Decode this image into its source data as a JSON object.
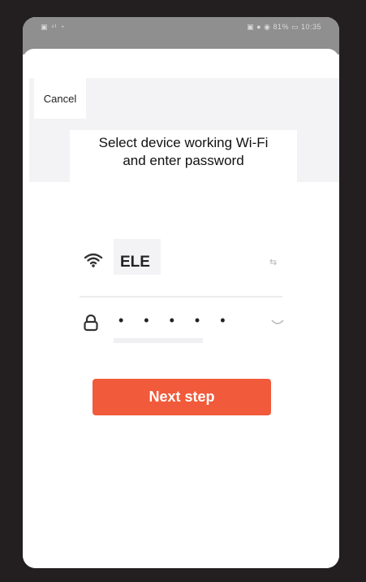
{
  "status_bar": {
    "left": "▣ ⁴ᴵ ◔",
    "right": "▣ ● ◉ 81% ▭ 10:35"
  },
  "header": {
    "cancel_label": "Cancel",
    "title_line1": "Select device working Wi-Fi",
    "title_line2": "and enter password"
  },
  "form": {
    "ssid_value": "ELE",
    "switch_label": "⇆",
    "password_value": "• • • • • •"
  },
  "actions": {
    "next_label": "Next step"
  },
  "colors": {
    "accent": "#f15a3a",
    "header_band": "#f3f3f6"
  }
}
